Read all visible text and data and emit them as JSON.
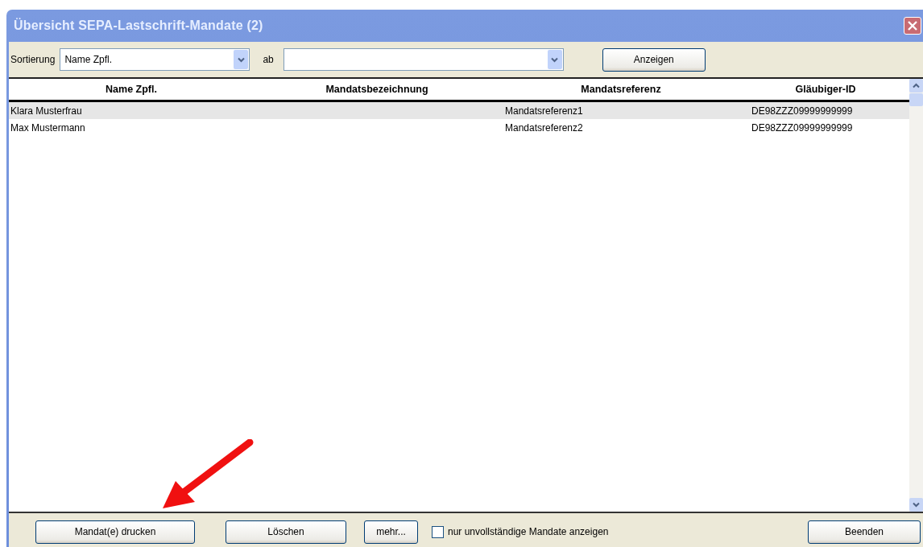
{
  "window": {
    "title": "Übersicht SEPA-Lastschrift-Mandate (2)"
  },
  "toolbar": {
    "sort_label": "Sortierung",
    "sort_value": "Name Zpfl.",
    "from_label": "ab",
    "show_button": "Anzeigen"
  },
  "table": {
    "columns": [
      "Name Zpfl.",
      "Mandatsbezeichnung",
      "Mandatsreferenz",
      "Gläubiger-ID"
    ],
    "rows": [
      {
        "name": "Klara Musterfrau",
        "reference": "Mandatsreferenz1",
        "creditor_id": "DE98ZZZ09999999999",
        "selected": true
      },
      {
        "name": "Max Mustermann",
        "reference": "Mandatsreferenz2",
        "creditor_id": "DE98ZZZ09999999999",
        "selected": false
      }
    ]
  },
  "footer": {
    "buttons": [
      "Mandat(e) drucken",
      "Löschen",
      "mehr..."
    ],
    "checkbox": {
      "label": "nur unvollständige Mandate anzeigen",
      "checked": false
    },
    "close_button": "Beenden"
  }
}
